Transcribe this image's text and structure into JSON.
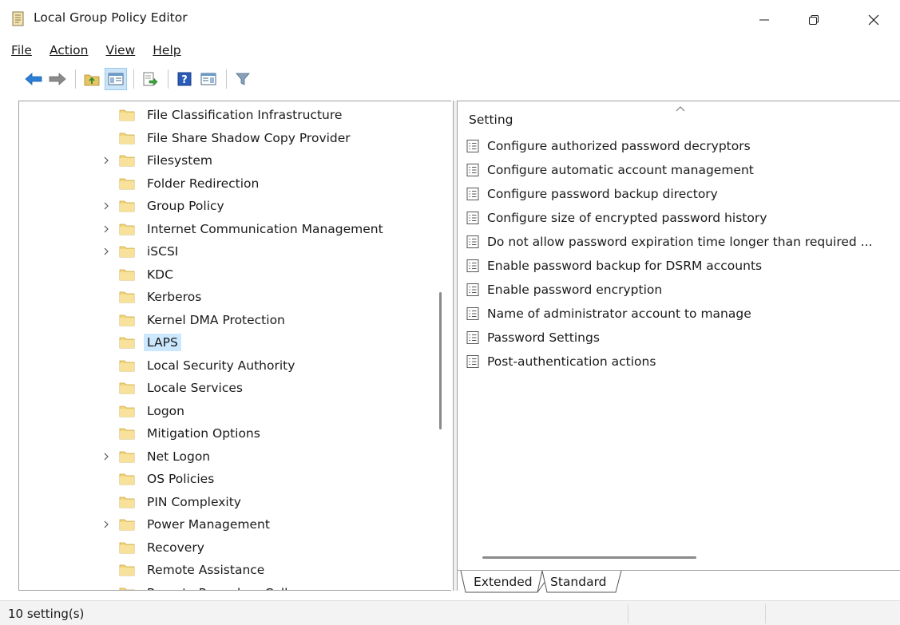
{
  "window": {
    "title": "Local Group Policy Editor"
  },
  "menubar": [
    {
      "label": "File"
    },
    {
      "label": "Action"
    },
    {
      "label": "View"
    },
    {
      "label": "Help"
    }
  ],
  "toolbar": {
    "buttons": [
      "back-icon",
      "forward-icon",
      "up-folder-icon",
      "show-hide-tree-icon",
      "export-list-icon",
      "help-icon",
      "show-hide-action-pane-icon",
      "filter-icon"
    ]
  },
  "tree": {
    "items": [
      {
        "label": "File Classification Infrastructure",
        "expandable": false,
        "selected": false
      },
      {
        "label": "File Share Shadow Copy Provider",
        "expandable": false,
        "selected": false
      },
      {
        "label": "Filesystem",
        "expandable": true,
        "selected": false
      },
      {
        "label": "Folder Redirection",
        "expandable": false,
        "selected": false
      },
      {
        "label": "Group Policy",
        "expandable": true,
        "selected": false
      },
      {
        "label": "Internet Communication Management",
        "expandable": true,
        "selected": false
      },
      {
        "label": "iSCSI",
        "expandable": true,
        "selected": false
      },
      {
        "label": "KDC",
        "expandable": false,
        "selected": false
      },
      {
        "label": "Kerberos",
        "expandable": false,
        "selected": false
      },
      {
        "label": "Kernel DMA Protection",
        "expandable": false,
        "selected": false
      },
      {
        "label": "LAPS",
        "expandable": false,
        "selected": true
      },
      {
        "label": "Local Security Authority",
        "expandable": false,
        "selected": false
      },
      {
        "label": "Locale Services",
        "expandable": false,
        "selected": false
      },
      {
        "label": "Logon",
        "expandable": false,
        "selected": false
      },
      {
        "label": "Mitigation Options",
        "expandable": false,
        "selected": false
      },
      {
        "label": "Net Logon",
        "expandable": true,
        "selected": false
      },
      {
        "label": "OS Policies",
        "expandable": false,
        "selected": false
      },
      {
        "label": "PIN Complexity",
        "expandable": false,
        "selected": false
      },
      {
        "label": "Power Management",
        "expandable": true,
        "selected": false
      },
      {
        "label": "Recovery",
        "expandable": false,
        "selected": false
      },
      {
        "label": "Remote Assistance",
        "expandable": false,
        "selected": false
      },
      {
        "label": "Remote Procedure Call",
        "expandable": false,
        "selected": false
      }
    ]
  },
  "settings": {
    "column_header": "Setting",
    "items": [
      "Configure authorized password decryptors",
      "Configure automatic account management",
      "Configure password backup directory",
      "Configure size of encrypted password history",
      "Do not allow password expiration time longer than required ...",
      "Enable password backup for DSRM accounts",
      "Enable password encryption",
      "Name of administrator account to manage",
      "Password Settings",
      "Post-authentication actions"
    ]
  },
  "tabs": [
    {
      "label": "Extended",
      "active": false
    },
    {
      "label": "Standard",
      "active": true
    }
  ],
  "statusbar": {
    "text": "10 setting(s)"
  }
}
